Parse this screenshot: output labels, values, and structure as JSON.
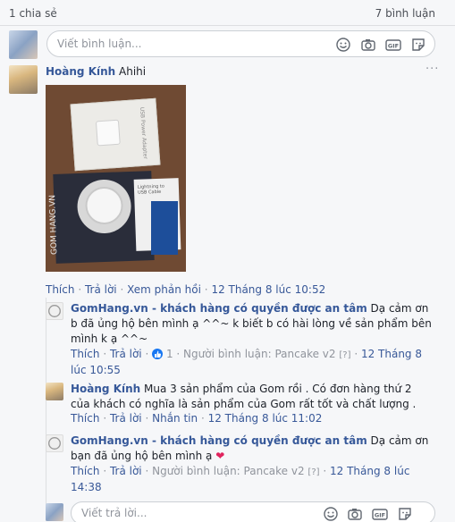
{
  "header": {
    "shares": "1 chia sẻ",
    "comments_count": "7 bình luận"
  },
  "composer": {
    "placeholder": "Viết bình luận..."
  },
  "comment": {
    "author": "Hoàng Kính",
    "text": "Ahihi",
    "photo": {
      "box_text": "USB Power Adapter",
      "brand_text": "GOM HANG.VN",
      "card_text": "Lightning to USB Cable"
    },
    "actions": {
      "like": "Thích",
      "reply": "Trả lời",
      "feedback": "Xem phản hồi",
      "time": "12 Tháng 8 lúc 10:52"
    }
  },
  "replies": [
    {
      "author": "GomHang.vn - khách hàng có quyền được an tâm",
      "text": "Dạ cảm ơn b đã ủng hộ bên mình ạ ^^~ k biết b có hài lòng về sản phẩm bên mình k ạ ^^~",
      "like": "Thích",
      "reply": "Trả lời",
      "like_count": "1",
      "commenter_prefix": "Người bình luận: Pancake v2",
      "bracket": "[?]",
      "time": "12 Tháng 8 lúc 10:55"
    },
    {
      "author": "Hoàng Kính",
      "text": "Mua 3 sản phẩm của Gom rồi . Có đơn hàng thứ 2 của khách có nghĩa là sản phẩm của Gom rất tốt và chất lượng .",
      "like": "Thích",
      "reply": "Trả lời",
      "message": "Nhắn tin",
      "time": "12 Tháng 8 lúc 11:02"
    },
    {
      "author": "GomHang.vn - khách hàng có quyền được an tâm",
      "text": "Dạ cảm ơn bạn đã ủng hộ bên mình ạ",
      "like": "Thích",
      "reply": "Trả lời",
      "commenter_prefix": "Người bình luận: Pancake v2",
      "bracket": "[?]",
      "time": "12 Tháng 8 lúc 14:38"
    }
  ],
  "reply_composer": {
    "placeholder": "Viết trả lời..."
  },
  "icons": {
    "emoji": "smile-icon",
    "camera": "camera-icon",
    "gif": "gif-icon",
    "sticker": "sticker-icon",
    "more": "more-icon"
  },
  "gif_label": "GIF",
  "colors": {
    "link": "#365899",
    "muted": "#90949c",
    "heart": "#e0245e",
    "like_badge": "#1877f2"
  }
}
